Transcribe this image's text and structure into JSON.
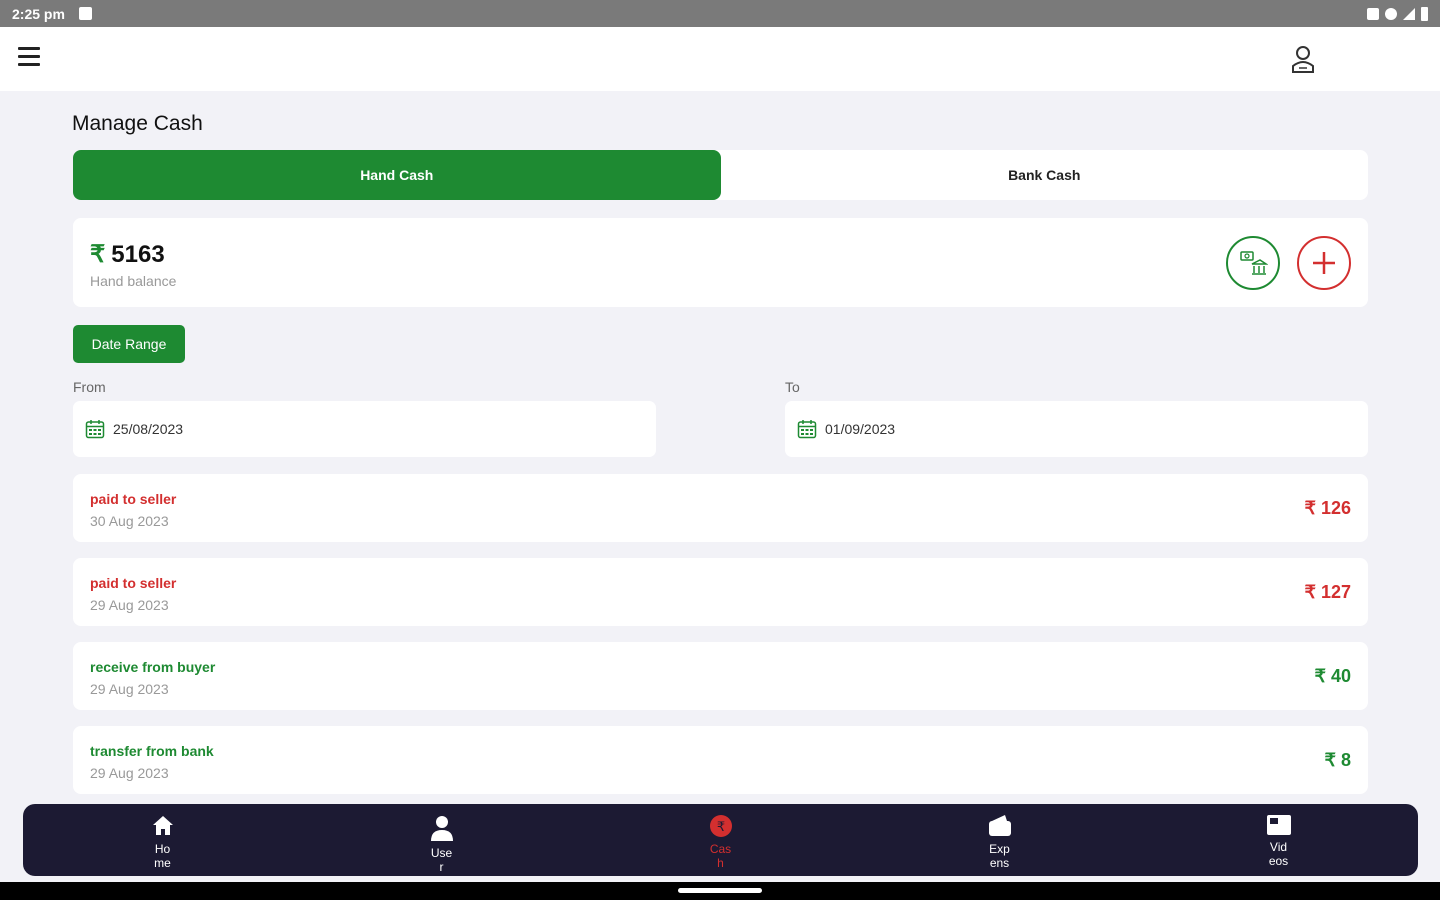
{
  "status_bar": {
    "time": "2:25 pm"
  },
  "page": {
    "title": "Manage Cash"
  },
  "tabs": [
    {
      "label": "Hand Cash",
      "active": true
    },
    {
      "label": "Bank Cash",
      "active": false
    }
  ],
  "balance": {
    "currency": "₹",
    "amount": "5163",
    "label": "Hand balance"
  },
  "filter": {
    "date_range_label": "Date Range",
    "from_label": "From",
    "from_value": "25/08/2023",
    "to_label": "To",
    "to_value": "01/09/2023"
  },
  "transactions": [
    {
      "title": "paid to seller",
      "date": "30 Aug 2023",
      "amount": "₹ 126",
      "type": "debit"
    },
    {
      "title": "paid to seller",
      "date": "29 Aug 2023",
      "amount": "₹ 127",
      "type": "debit"
    },
    {
      "title": "receive from buyer",
      "date": "29 Aug 2023",
      "amount": "₹ 40",
      "type": "credit"
    },
    {
      "title": "transfer from bank",
      "date": "29 Aug 2023",
      "amount": "₹ 8",
      "type": "credit"
    }
  ],
  "bottom_nav": [
    {
      "label": "Home",
      "icon": "home-icon"
    },
    {
      "label": "User",
      "icon": "user-icon"
    },
    {
      "label": "Cash",
      "icon": "cash-icon",
      "active": true
    },
    {
      "label": "Expenses",
      "icon": "wallet-icon"
    },
    {
      "label": "Videos",
      "icon": "video-icon"
    }
  ],
  "colors": {
    "primary_green": "#1e8a32",
    "debit_red": "#d32f2f",
    "nav_bg": "#1c1a33"
  }
}
